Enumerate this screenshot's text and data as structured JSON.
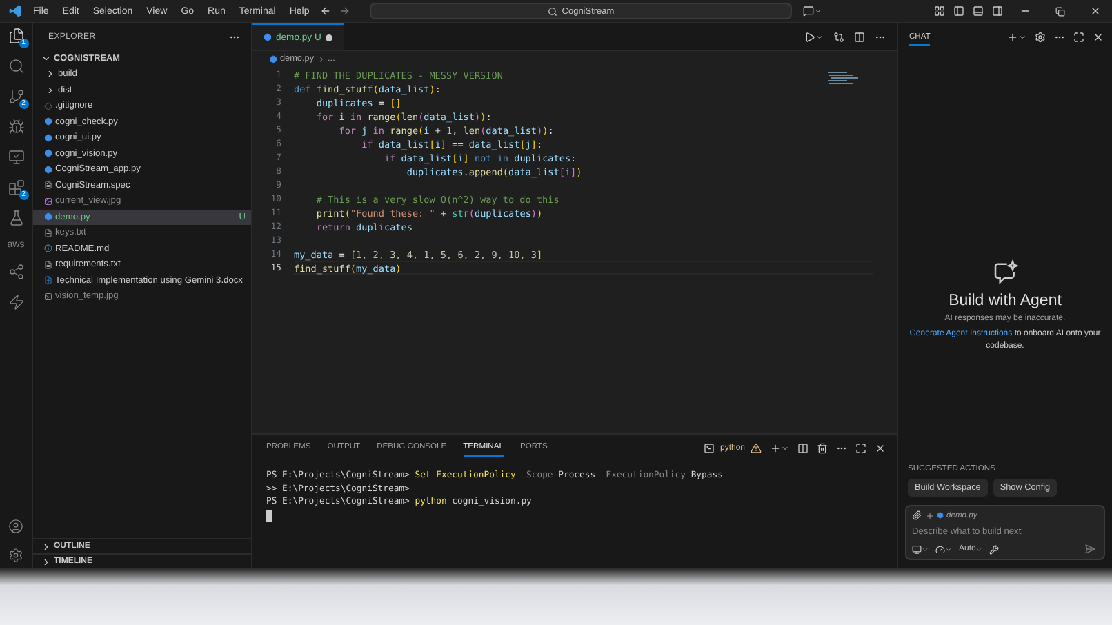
{
  "menu": [
    "File",
    "Edit",
    "Selection",
    "View",
    "Go",
    "Run",
    "Terminal",
    "Help"
  ],
  "command_center": {
    "value": "CogniStream"
  },
  "activity_bar": [
    {
      "kind": "files",
      "badge": "1",
      "selected": true
    },
    {
      "kind": "search",
      "selected": false
    },
    {
      "kind": "source-control",
      "badge": "2",
      "selected": false
    },
    {
      "kind": "run",
      "selected": false
    },
    {
      "kind": "remote",
      "selected": false
    },
    {
      "kind": "extensions",
      "badge": "2",
      "selected": false
    },
    {
      "kind": "testing",
      "selected": false
    },
    {
      "kind": "text",
      "label": "aws",
      "selected": false
    },
    {
      "kind": "share",
      "selected": false
    },
    {
      "kind": "bolt",
      "selected": false
    }
  ],
  "explorer": {
    "title": "EXPLORER",
    "root": "COGNISTREAM",
    "items": [
      {
        "name": "build",
        "kind": "folder",
        "expanded": false,
        "selected": false,
        "ignored": false
      },
      {
        "name": "dist",
        "kind": "folder",
        "expanded": false,
        "selected": false,
        "ignored": false
      },
      {
        "name": ".gitignore",
        "kind": "git",
        "selected": false,
        "ignored": false
      },
      {
        "name": "cogni_check.py",
        "kind": "python",
        "selected": false,
        "ignored": false
      },
      {
        "name": "cogni_ui.py",
        "kind": "python",
        "selected": false,
        "ignored": false
      },
      {
        "name": "cogni_vision.py",
        "kind": "python",
        "selected": false,
        "ignored": false
      },
      {
        "name": "CogniStream_app.py",
        "kind": "python",
        "selected": false,
        "ignored": false
      },
      {
        "name": "CogniStream.spec",
        "kind": "text",
        "selected": false,
        "ignored": false
      },
      {
        "name": "current_view.jpg",
        "kind": "image",
        "selected": false,
        "ignored": true
      },
      {
        "name": "demo.py",
        "kind": "python",
        "selected": true,
        "ignored": false,
        "status": "U"
      },
      {
        "name": "keys.txt",
        "kind": "text",
        "selected": false,
        "ignored": true
      },
      {
        "name": "README.md",
        "kind": "info",
        "selected": false,
        "ignored": false
      },
      {
        "name": "requirements.txt",
        "kind": "text",
        "selected": false,
        "ignored": false
      },
      {
        "name": "Technical Implementation using Gemini 3.docx",
        "kind": "word",
        "selected": false,
        "ignored": false
      },
      {
        "name": "vision_temp.jpg",
        "kind": "image",
        "selected": false,
        "ignored": true
      }
    ],
    "sections": [
      {
        "title": "OUTLINE",
        "expanded": false
      },
      {
        "title": "TIMELINE",
        "expanded": false
      }
    ]
  },
  "editor": {
    "tab": {
      "name": "demo.py",
      "status": "U",
      "modified": true
    },
    "breadcrumb": [
      "demo.py",
      "..."
    ],
    "lines": [
      {
        "number": "1",
        "current": false,
        "tokens": [
          {
            "kind": "comment",
            "text": "# FIND THE DUPLICATES - MESSY VERSION"
          }
        ]
      },
      {
        "number": "2",
        "current": false,
        "tokens": [
          {
            "kind": "storage",
            "text": "def "
          },
          {
            "kind": "func",
            "text": "find_stuff"
          },
          {
            "kind": "b1",
            "text": "("
          },
          {
            "kind": "var",
            "text": "data_list"
          },
          {
            "kind": "b1",
            "text": ")"
          },
          {
            "kind": "plain",
            "text": ":"
          }
        ]
      },
      {
        "number": "3",
        "current": false,
        "tokens": [
          {
            "kind": "var",
            "text": "    duplicates"
          },
          {
            "kind": "plain",
            "text": " = "
          },
          {
            "kind": "b1",
            "text": "[]"
          }
        ]
      },
      {
        "number": "4",
        "current": false,
        "tokens": [
          {
            "kind": "control",
            "text": "    for "
          },
          {
            "kind": "var",
            "text": "i"
          },
          {
            "kind": "control",
            "text": " in "
          },
          {
            "kind": "func",
            "text": "range"
          },
          {
            "kind": "b1",
            "text": "("
          },
          {
            "kind": "func",
            "text": "len"
          },
          {
            "kind": "b2",
            "text": "("
          },
          {
            "kind": "var",
            "text": "data_list"
          },
          {
            "kind": "b2",
            "text": ")"
          },
          {
            "kind": "b1",
            "text": ")"
          },
          {
            "kind": "plain",
            "text": ":"
          }
        ]
      },
      {
        "number": "5",
        "current": false,
        "tokens": [
          {
            "kind": "control",
            "text": "        for "
          },
          {
            "kind": "var",
            "text": "j"
          },
          {
            "kind": "control",
            "text": " in "
          },
          {
            "kind": "func",
            "text": "range"
          },
          {
            "kind": "b1",
            "text": "("
          },
          {
            "kind": "var",
            "text": "i"
          },
          {
            "kind": "plain",
            "text": " + "
          },
          {
            "kind": "number",
            "text": "1"
          },
          {
            "kind": "plain",
            "text": ", "
          },
          {
            "kind": "func",
            "text": "len"
          },
          {
            "kind": "b2",
            "text": "("
          },
          {
            "kind": "var",
            "text": "data_list"
          },
          {
            "kind": "b2",
            "text": ")"
          },
          {
            "kind": "b1",
            "text": ")"
          },
          {
            "kind": "plain",
            "text": ":"
          }
        ]
      },
      {
        "number": "6",
        "current": false,
        "tokens": [
          {
            "kind": "control",
            "text": "            if "
          },
          {
            "kind": "var",
            "text": "data_list"
          },
          {
            "kind": "b1",
            "text": "["
          },
          {
            "kind": "var",
            "text": "i"
          },
          {
            "kind": "b1",
            "text": "]"
          },
          {
            "kind": "plain",
            "text": " == "
          },
          {
            "kind": "var",
            "text": "data_list"
          },
          {
            "kind": "b1",
            "text": "["
          },
          {
            "kind": "var",
            "text": "j"
          },
          {
            "kind": "b1",
            "text": "]"
          },
          {
            "kind": "plain",
            "text": ":"
          }
        ]
      },
      {
        "number": "7",
        "current": false,
        "tokens": [
          {
            "kind": "control",
            "text": "                if "
          },
          {
            "kind": "var",
            "text": "data_list"
          },
          {
            "kind": "b1",
            "text": "["
          },
          {
            "kind": "var",
            "text": "i"
          },
          {
            "kind": "b1",
            "text": "]"
          },
          {
            "kind": "storage",
            "text": " not in "
          },
          {
            "kind": "var",
            "text": "duplicates"
          },
          {
            "kind": "plain",
            "text": ":"
          }
        ]
      },
      {
        "number": "8",
        "current": false,
        "tokens": [
          {
            "kind": "var",
            "text": "                    duplicates"
          },
          {
            "kind": "plain",
            "text": "."
          },
          {
            "kind": "func",
            "text": "append"
          },
          {
            "kind": "b1",
            "text": "("
          },
          {
            "kind": "var",
            "text": "data_list"
          },
          {
            "kind": "b2",
            "text": "["
          },
          {
            "kind": "var",
            "text": "i"
          },
          {
            "kind": "b2",
            "text": "]"
          },
          {
            "kind": "b1",
            "text": ")"
          }
        ]
      },
      {
        "number": "9",
        "current": false
      },
      {
        "number": "10",
        "current": false,
        "tokens": [
          {
            "kind": "comment",
            "text": "    # This is a very slow O(n^2) way to do this"
          }
        ]
      },
      {
        "number": "11",
        "current": false,
        "tokens": [
          {
            "kind": "func",
            "text": "    print"
          },
          {
            "kind": "b1",
            "text": "("
          },
          {
            "kind": "string",
            "text": "\"Found these: \""
          },
          {
            "kind": "plain",
            "text": " + "
          },
          {
            "kind": "type",
            "text": "str"
          },
          {
            "kind": "b2",
            "text": "("
          },
          {
            "kind": "var",
            "text": "duplicates"
          },
          {
            "kind": "b2",
            "text": ")"
          },
          {
            "kind": "b1",
            "text": ")"
          }
        ]
      },
      {
        "number": "12",
        "current": false,
        "tokens": [
          {
            "kind": "control",
            "text": "    return "
          },
          {
            "kind": "var",
            "text": "duplicates"
          }
        ]
      },
      {
        "number": "13",
        "current": false
      },
      {
        "number": "14",
        "current": false,
        "tokens": [
          {
            "kind": "var",
            "text": "my_data"
          },
          {
            "kind": "plain",
            "text": " = "
          },
          {
            "kind": "b1",
            "text": "["
          },
          {
            "kind": "number",
            "text": "1, 2, 3, 4, 1, 5, 6, 2, 9, 10, 3"
          },
          {
            "kind": "b1",
            "text": "]"
          }
        ]
      },
      {
        "number": "15",
        "current": true,
        "tokens": [
          {
            "kind": "func",
            "text": "find_stuff"
          },
          {
            "kind": "b1",
            "text": "("
          },
          {
            "kind": "var",
            "text": "my_data"
          },
          {
            "kind": "b1",
            "text": ")"
          }
        ]
      }
    ]
  },
  "panel": {
    "tabs": [
      {
        "label": "PROBLEMS",
        "selected": false
      },
      {
        "label": "OUTPUT",
        "selected": false
      },
      {
        "label": "DEBUG CONSOLE",
        "selected": false
      },
      {
        "label": "TERMINAL",
        "selected": true
      },
      {
        "label": "PORTS",
        "selected": false
      }
    ],
    "terminal_name": "python",
    "lines": [
      [
        {
          "kind": "plain",
          "text": "PS E:\\Projects\\CogniStream> "
        },
        {
          "kind": "cmd",
          "text": "Set-ExecutionPolicy"
        },
        {
          "kind": "param",
          "text": " -Scope"
        },
        {
          "kind": "plain",
          "text": " Process"
        },
        {
          "kind": "param",
          "text": " -ExecutionPolicy"
        },
        {
          "kind": "plain",
          "text": " Bypass"
        }
      ],
      [
        {
          "kind": "plain",
          "text": ">> E:\\Projects\\CogniStream>"
        }
      ],
      [
        {
          "kind": "plain",
          "text": "PS E:\\Projects\\CogniStream> "
        },
        {
          "kind": "cmd",
          "text": "python"
        },
        {
          "kind": "plain",
          "text": " cogni_vision.py"
        }
      ]
    ]
  },
  "chat": {
    "title": "CHAT",
    "heading": "Build with Agent",
    "note": "AI responses may be inaccurate.",
    "link": "Generate Agent Instructions",
    "link_rest": "to onboard AI onto your codebase.",
    "suggested_title": "SUGGESTED ACTIONS",
    "suggested": [
      "Build Workspace",
      "Show Config"
    ],
    "input": {
      "attachment": "demo.py",
      "placeholder": "Describe what to build next",
      "mode": "Auto"
    }
  }
}
